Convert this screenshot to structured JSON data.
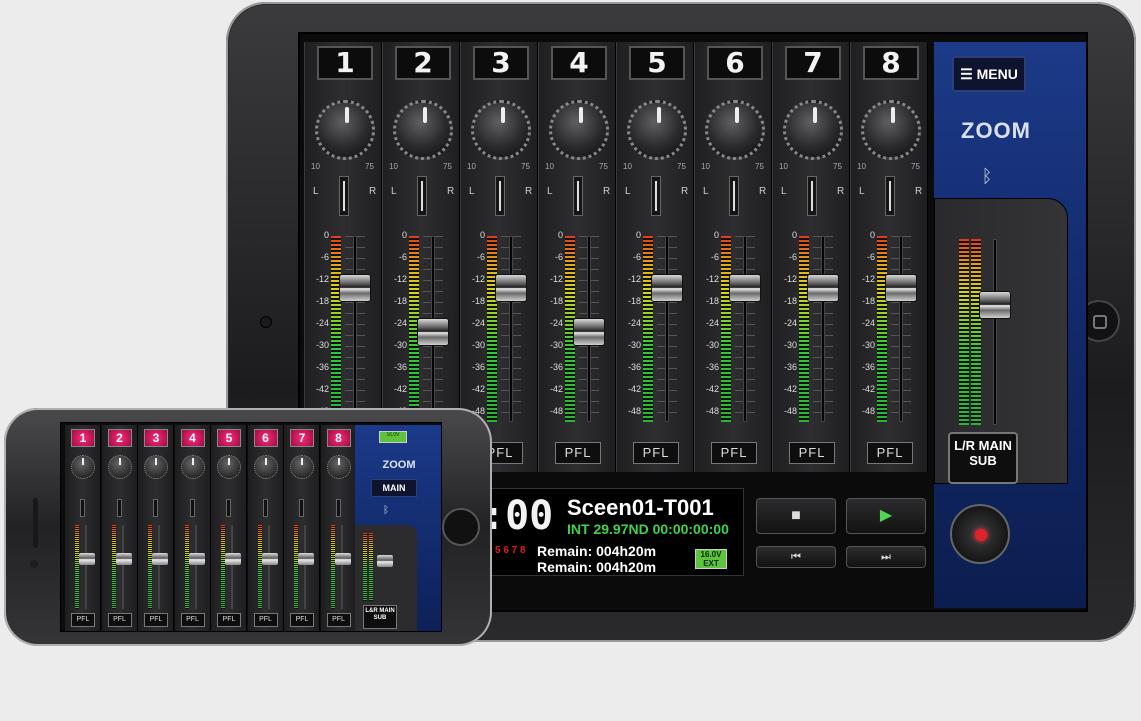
{
  "ipad": {
    "channels": [
      "1",
      "2",
      "3",
      "4",
      "5",
      "6",
      "7",
      "8"
    ],
    "knob_min": "10",
    "knob_max": "75",
    "pan_left": "L",
    "pan_right": "R",
    "db_scale": [
      "0",
      "-6",
      "-12",
      "-18",
      "-24",
      "-30",
      "-36",
      "-42",
      "-48"
    ],
    "pfl_label": "PFL",
    "menu_label": "MENU",
    "brand": "ZOOM",
    "master_label": "L/R MAIN SUB",
    "transport": {
      "timecode": ":00",
      "scene": "Sceen01-T001",
      "tc_line": "INT 29.97ND 00:00:00:00",
      "track_lamps": "5 6 7 8",
      "remain_1": "Remain: 004h20m",
      "remain_2": "Remain: 004h20m",
      "battery": "16.0V EXT"
    },
    "buttons": {
      "stop": "■",
      "play": "▶",
      "rewind": "⏮",
      "ffwd": "⏭"
    }
  },
  "iphone": {
    "channels": [
      "1",
      "2",
      "3",
      "4",
      "5",
      "6",
      "7",
      "8"
    ],
    "pfl_label": "PFL",
    "brand": "ZOOM",
    "main_label": "MAIN",
    "master_label": "L&R MAIN SUB",
    "battery": "16.0V"
  },
  "colors": {
    "panel_blue": "#12296a",
    "meter_green": "#33c83a",
    "rec_red": "#e0222a",
    "channel_pink": "#ff2a7a"
  }
}
